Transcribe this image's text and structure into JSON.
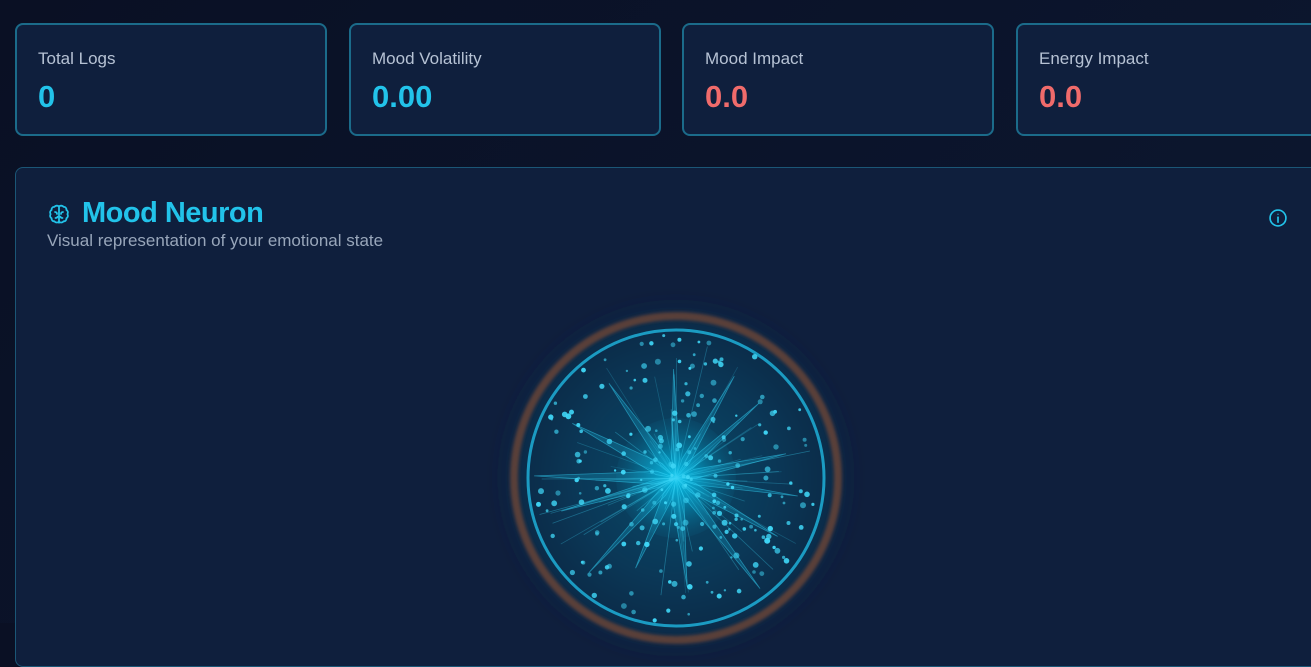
{
  "stats": [
    {
      "label": "Total Logs",
      "value": "0",
      "color": "#22c3ea"
    },
    {
      "label": "Mood Volatility",
      "value": "0.00",
      "color": "#22c3ea"
    },
    {
      "label": "Mood Impact",
      "value": "0.0",
      "color": "#f06b6b"
    },
    {
      "label": "Energy Impact",
      "value": "0.0",
      "color": "#f06b6b"
    }
  ],
  "panel": {
    "title": "Mood Neuron",
    "subtitle": "Visual representation of your emotional state",
    "title_icon": "brain-icon",
    "info_icon": "info-icon"
  },
  "colors": {
    "accent": "#22c3ea",
    "negative": "#f06b6b",
    "card_border": "#1b6b8a",
    "card_bg": "#0f1f3d",
    "neuron_glow": "#00bfe6"
  }
}
